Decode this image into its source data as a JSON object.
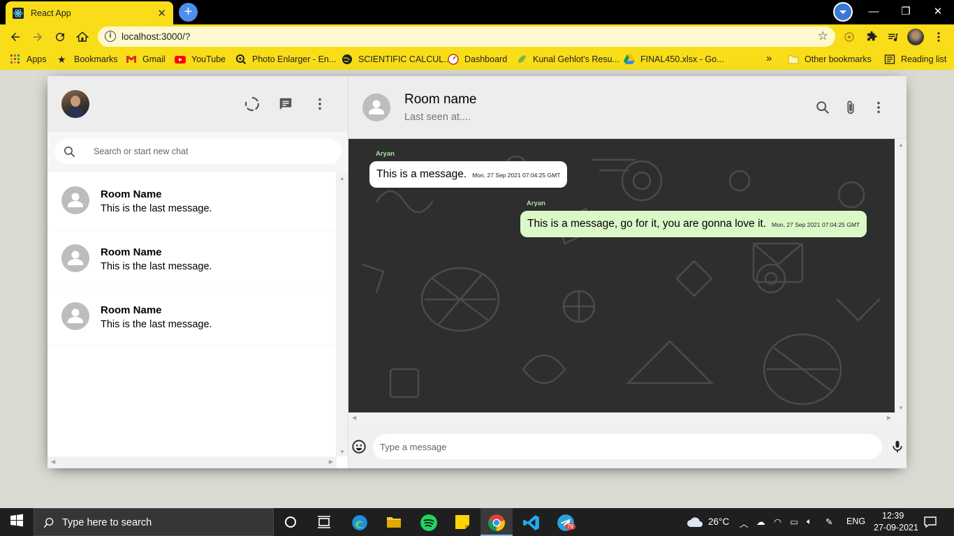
{
  "browser": {
    "tab_title": "React App",
    "url": "localhost:3000/?",
    "bookmarks": [
      {
        "label": "Apps"
      },
      {
        "label": "Bookmarks"
      },
      {
        "label": "Gmail"
      },
      {
        "label": "YouTube"
      },
      {
        "label": "Photo Enlarger - En..."
      },
      {
        "label": "SCIENTIFIC CALCUL..."
      },
      {
        "label": "Dashboard"
      },
      {
        "label": "Kunal Gehlot's Resu..."
      },
      {
        "label": "FINAL450.xlsx - Go..."
      }
    ],
    "overflow_label": "»",
    "other_bookmarks": "Other bookmarks",
    "reading_list": "Reading list",
    "accent_color": "#f9dd18"
  },
  "sidebar": {
    "search_placeholder": "Search or start new chat",
    "chats": [
      {
        "name": "Room Name",
        "last": "This is the last message."
      },
      {
        "name": "Room Name",
        "last": "This is the last message."
      },
      {
        "name": "Room Name",
        "last": "This is the last message."
      }
    ]
  },
  "chat": {
    "title": "Room name",
    "subtitle": "Last seen at....",
    "messages": [
      {
        "sender": "Aryan",
        "text": "This is a message.",
        "time": "Mon, 27 Sep 2021 07:04:25 GMT",
        "own": false
      },
      {
        "sender": "Aryan",
        "text": "This is a message, go for it, you are gonna love it.",
        "time": "Mon, 27 Sep 2021 07:04:25 GMT",
        "own": true
      }
    ],
    "input_placeholder": "Type a message",
    "received_color": "#ffffff",
    "sent_color": "#dcf8c6"
  },
  "taskbar": {
    "search_placeholder": "Type here to search",
    "weather": "26°C",
    "language": "ENG",
    "time": "12:39",
    "date": "27-09-2021",
    "telegram_badge": "79"
  }
}
